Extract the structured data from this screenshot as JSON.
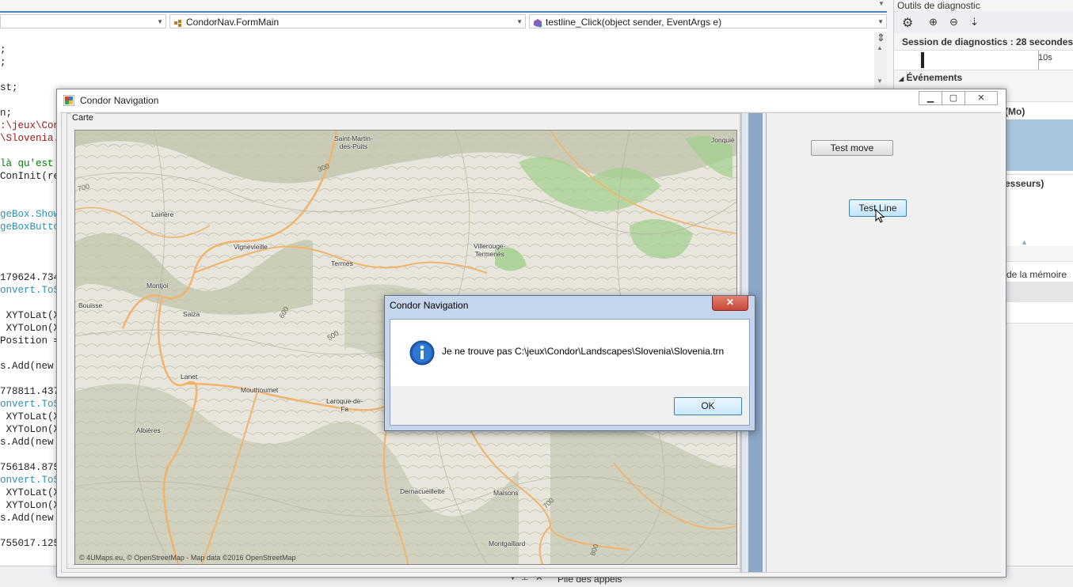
{
  "vs": {
    "nav_left": "",
    "nav_class": "CondorNav.FormMain",
    "nav_method": "testline_Click(object sender, EventArgs e)",
    "code_lines": [
      {
        "t": ";",
        "c": "c-dark"
      },
      {
        "t": ";",
        "c": "c-dark"
      },
      {
        "t": "",
        "c": "c-dark"
      },
      {
        "t": "st;",
        "c": "c-dark"
      },
      {
        "t": "",
        "c": "c-dark"
      },
      {
        "t": "n;",
        "c": "c-dark"
      },
      {
        "t": ":\\jeux\\Cond",
        "c": "c-red"
      },
      {
        "t": "\\Slovenia.t",
        "c": "c-red"
      },
      {
        "t": "",
        "c": "c-dark"
      },
      {
        "t": "là qu'est l",
        "c": "c-green"
      },
      {
        "t": "ConInit(ref",
        "c": "c-dark"
      },
      {
        "t": "",
        "c": "c-dark"
      },
      {
        "t": "",
        "c": "c-dark"
      },
      {
        "t": "geBox.Show(",
        "c": "c-teal"
      },
      {
        "t": "geBoxButton",
        "c": "c-teal"
      },
      {
        "t": "",
        "c": "c-dark"
      },
      {
        "t": "",
        "c": "c-dark"
      },
      {
        "t": "",
        "c": "c-dark"
      },
      {
        "t": "179624.7343",
        "c": "c-dark"
      },
      {
        "t": "onvert.ToSi",
        "c": "c-teal"
      },
      {
        "t": "",
        "c": "c-dark"
      },
      {
        "t": " XYToLat(X,",
        "c": "c-dark"
      },
      {
        "t": " XYToLon(X,",
        "c": "c-dark"
      },
      {
        "t": "Position = ",
        "c": "c-dark"
      },
      {
        "t": "",
        "c": "c-dark"
      },
      {
        "t": "s.Add(new P",
        "c": "c-dark"
      },
      {
        "t": "",
        "c": "c-dark"
      },
      {
        "t": "778811.4375",
        "c": "c-dark"
      },
      {
        "t": "onvert.ToSi",
        "c": "c-teal"
      },
      {
        "t": " XYToLat(X,",
        "c": "c-dark"
      },
      {
        "t": " XYToLon(X,",
        "c": "c-dark"
      },
      {
        "t": "s.Add(new P",
        "c": "c-dark"
      },
      {
        "t": "",
        "c": "c-dark"
      },
      {
        "t": "756184.875;",
        "c": "c-dark"
      },
      {
        "t": "onvert.ToSi",
        "c": "c-teal"
      },
      {
        "t": " XYToLat(X,",
        "c": "c-dark"
      },
      {
        "t": " XYToLon(X,",
        "c": "c-dark"
      },
      {
        "t": "s.Add(new P",
        "c": "c-dark"
      },
      {
        "t": "",
        "c": "c-dark"
      },
      {
        "t": "755017.125;",
        "c": "c-dark"
      }
    ]
  },
  "diag": {
    "title": "Outils de diagnostic",
    "session": "Session de diagnostics : 28 secondes",
    "tick": "10s",
    "events": "Événements",
    "mem_label": "(Mo)",
    "cpu_label": "esseurs)",
    "mem_usage": "de la mémoire"
  },
  "statusbar": {
    "call_stack": "Pile des appels"
  },
  "main_window": {
    "title": "Condor Navigation",
    "group_label": "Carte",
    "attribution": "© 4UMaps.eu, © OpenStreetMap - Map data ©2016 OpenStreetMap",
    "btn_test_move": "Test move",
    "btn_test_line": "Test Line",
    "places": [
      {
        "name": "Saint-Martin-\ndes-Puits"
      },
      {
        "name": "Jonquiè"
      },
      {
        "name": "Lairière"
      },
      {
        "name": "Vignevieille"
      },
      {
        "name": "Termes"
      },
      {
        "name": "Villerouge-\nTermenès"
      },
      {
        "name": "Montjoi"
      },
      {
        "name": "Bouisse"
      },
      {
        "name": "Saiza"
      },
      {
        "name": "Lanet"
      },
      {
        "name": "Mouthoumet"
      },
      {
        "name": "Laroque-de-\nFa"
      },
      {
        "name": "Albières"
      },
      {
        "name": "Dernacueillette"
      },
      {
        "name": "Maisons"
      },
      {
        "name": "Montgaillard"
      }
    ],
    "contours": [
      "300",
      "700",
      "600",
      "500",
      "700",
      "800"
    ]
  },
  "dialog": {
    "title": "Condor Navigation",
    "message": "Je ne trouve pas C:\\jeux\\Condor\\Landscapes\\Slovenia\\Slovenia.trn",
    "ok": "OK"
  },
  "colors": {
    "vs_accent": "#4a7fc1",
    "map_base": "#e8e6dc",
    "map_relief": "#bfc2aa",
    "map_green": "#9fcf8a",
    "road": "#f2b36a",
    "dialog_frame": "#c5d5ec",
    "close_red": "#c8463a",
    "info_blue": "#1f5fb8"
  }
}
